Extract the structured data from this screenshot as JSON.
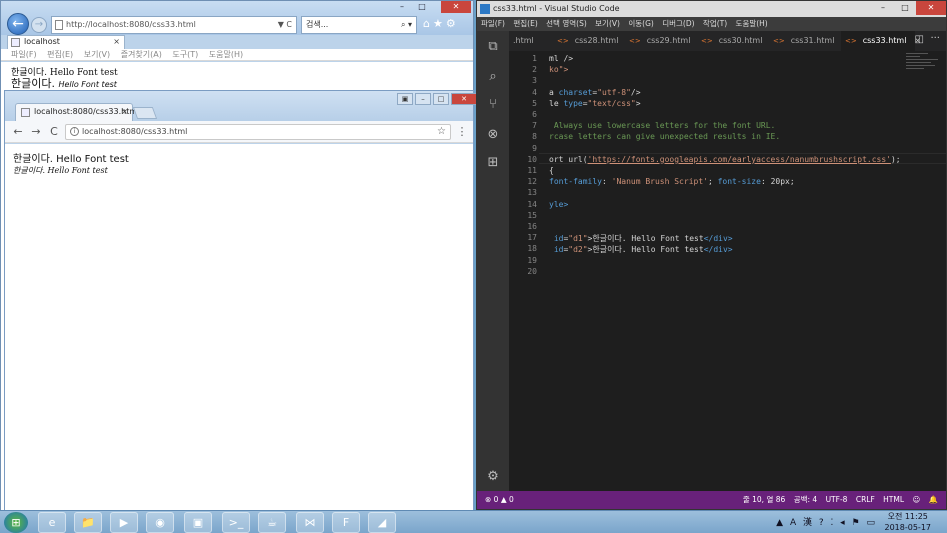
{
  "ie": {
    "url": "http://localhost:8080/css33.html",
    "url_tail": "▼ C",
    "search_placeholder": "검색...",
    "search_tail": "⌕ ▾",
    "toolbar_icons": "⌂★⚙",
    "window_min": "–",
    "window_max": "□",
    "window_close": "✕",
    "tab_title": "localhost",
    "tab_close": "×",
    "menu": [
      "파일(F)",
      "편집(E)",
      "보기(V)",
      "즐겨찾기(A)",
      "도구(T)",
      "도움말(H)"
    ],
    "line1": "한글이다. Hello Font test",
    "line2_korean": "한글이다.",
    "line2_brush": "Hello Font test"
  },
  "chrome": {
    "tab_title": "localhost:8080/css33.htm",
    "tab_close": "×",
    "back": "←",
    "forward": "→",
    "reload": "C",
    "url": "localhost:8080/css33.html",
    "info": "i",
    "bookmark": "☆",
    "menu": "⋮",
    "window_controls": [
      "▣",
      "–",
      "□",
      "✕"
    ],
    "line1": "한글이다. Hello Font test",
    "line2": "한글이다. Hello Font test"
  },
  "vscode": {
    "title": "css33.html - Visual Studio Code",
    "window_min": "–",
    "window_max": "□",
    "window_close": "✕",
    "menu": [
      "파일(F)",
      "편집(E)",
      "선택 영역(S)",
      "보기(V)",
      "이동(G)",
      "디버그(D)",
      "작업(T)",
      "도움말(H)"
    ],
    "tabs": [
      {
        "label": ".html",
        "marker": ""
      },
      {
        "label": "css28.html",
        "marker": "<>"
      },
      {
        "label": "css29.html",
        "marker": "<>"
      },
      {
        "label": "css30.html",
        "marker": "<>"
      },
      {
        "label": "css31.html",
        "marker": "<>"
      },
      {
        "label": "css33.html",
        "marker": "<>",
        "active": true
      }
    ],
    "tab_close": "×",
    "tab_split": "◫",
    "tab_more": "···",
    "activity_icons": [
      "⧉",
      "⌕",
      "⑂",
      "⊗",
      "⊞"
    ],
    "settings_icon": "⚙",
    "line_numbers": [
      "1",
      "2",
      "3",
      "4",
      "5",
      "6",
      "7",
      "8",
      "9",
      "10",
      "11",
      "12",
      "13",
      "14",
      "15",
      "16",
      "17",
      "18",
      "19",
      "20"
    ],
    "lines": [
      {
        "parts": [
          {
            "t": "ml />",
            "c": ""
          }
        ]
      },
      {
        "parts": [
          {
            "t": "ko\">",
            "c": "str"
          }
        ]
      },
      {
        "parts": []
      },
      {
        "parts": [
          {
            "t": "a ",
            "c": ""
          },
          {
            "t": "charset",
            "c": "kw"
          },
          {
            "t": "=",
            "c": ""
          },
          {
            "t": "\"utf-8\"",
            "c": "str"
          },
          {
            "t": "/>",
            "c": ""
          }
        ]
      },
      {
        "parts": [
          {
            "t": "le ",
            "c": ""
          },
          {
            "t": "type",
            "c": "kw"
          },
          {
            "t": "=",
            "c": ""
          },
          {
            "t": "\"text/css\"",
            "c": "str"
          },
          {
            "t": ">",
            "c": ""
          }
        ]
      },
      {
        "parts": []
      },
      {
        "parts": [
          {
            "t": " Always use lowercase letters for the font URL.",
            "c": "cmt"
          }
        ]
      },
      {
        "parts": [
          {
            "t": "rcase letters can give unexpected results in IE.",
            "c": "cmt"
          }
        ]
      },
      {
        "parts": []
      },
      {
        "parts": [
          {
            "t": "ort url(",
            "c": ""
          },
          {
            "t": "'https://fonts.googleapis.com/earlyaccess/nanumbrushscript.css'",
            "c": "url"
          },
          {
            "t": ");",
            "c": ""
          }
        ]
      },
      {
        "parts": [
          {
            "t": "{",
            "c": ""
          }
        ]
      },
      {
        "parts": [
          {
            "t": "font-family",
            "c": "kw"
          },
          {
            "t": ": ",
            "c": ""
          },
          {
            "t": "'Nanum Brush Script'",
            "c": "str"
          },
          {
            "t": "; ",
            "c": ""
          },
          {
            "t": "font-size",
            "c": "kw"
          },
          {
            "t": ": 20px;",
            "c": ""
          }
        ]
      },
      {
        "parts": []
      },
      {
        "parts": [
          {
            "t": "yle>",
            "c": "kw"
          }
        ]
      },
      {
        "parts": []
      },
      {
        "parts": []
      },
      {
        "parts": [
          {
            "t": " id",
            "c": "kw"
          },
          {
            "t": "=",
            "c": ""
          },
          {
            "t": "\"d1\"",
            "c": "str"
          },
          {
            "t": ">한글이다. Hello Font test",
            "c": ""
          },
          {
            "t": "</div>",
            "c": "kw"
          }
        ]
      },
      {
        "parts": [
          {
            "t": " id",
            "c": "kw"
          },
          {
            "t": "=",
            "c": ""
          },
          {
            "t": "\"d2\"",
            "c": "str"
          },
          {
            "t": ">한글이다. Hello Font test",
            "c": ""
          },
          {
            "t": "</div>",
            "c": "kw"
          }
        ]
      },
      {
        "parts": []
      },
      {
        "parts": []
      }
    ],
    "status": {
      "problems": "⊗ 0 ▲ 0",
      "position": "줄 10, 열 86",
      "spaces": "공백: 4",
      "encoding": "UTF-8",
      "eol": "CRLF",
      "language": "HTML",
      "feedback": "☺",
      "bell": "🔔"
    }
  },
  "taskbar": {
    "start": "⊞",
    "apps": [
      "e",
      "📁",
      "▶",
      "◉",
      "▣",
      ">_",
      "☕",
      "⋈",
      "F",
      "◢"
    ],
    "tray": "▲ A 漢 ? ⁚ ◂ ⚑ ▭",
    "time": "오전 11:25",
    "date": "2018-05-17"
  }
}
